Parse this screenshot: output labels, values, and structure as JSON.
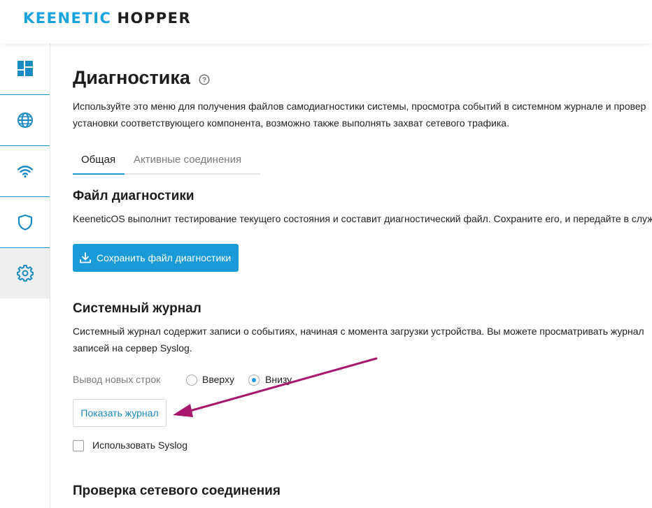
{
  "header": {
    "brand": "KEENETIC",
    "product": "HOPPER"
  },
  "sidebar": {
    "items": [
      {
        "icon": "dashboard-icon",
        "active": false
      },
      {
        "icon": "globe-icon",
        "active": false
      },
      {
        "icon": "wifi-icon",
        "active": false
      },
      {
        "icon": "shield-icon",
        "active": false
      },
      {
        "icon": "gear-icon",
        "active": true
      }
    ]
  },
  "page": {
    "title": "Диагностика",
    "help_icon": "question-circle-icon",
    "description_line1": "Используйте это меню для получения файлов самодиагностики системы, просмотра событий в системном журнале и провер",
    "description_line2": "установки соответствующего компонента, возможно также выполнять захват сетевого трафика."
  },
  "tabs": [
    {
      "label": "Общая",
      "active": true
    },
    {
      "label": "Активные соединения",
      "active": false
    }
  ],
  "diag_file": {
    "title": "Файл диагностики",
    "description": "KeeneticOS выполнит тестирование текущего состояния и составит диагностический файл. Сохраните его, и передайте в служ",
    "save_button": "Сохранить файл диагностики",
    "save_icon": "download-icon"
  },
  "syslog": {
    "title": "Системный журнал",
    "description_line1": "Системный журнал содержит записи о событиях, начиная с момента загрузки устройства. Вы можете просматривать журнал",
    "description_line2": "записей на сервер Syslog.",
    "output_label": "Вывод новых строк",
    "options": [
      {
        "label": "Вверху",
        "checked": false
      },
      {
        "label": "Внизу",
        "checked": true
      }
    ],
    "show_log_button": "Показать журнал",
    "use_syslog_label": "Использовать Syslog",
    "use_syslog_checked": false
  },
  "network_check": {
    "title": "Проверка сетевого соединения"
  },
  "colors": {
    "accent": "#1a9ad6",
    "annotation_arrow": "#a8176b"
  }
}
